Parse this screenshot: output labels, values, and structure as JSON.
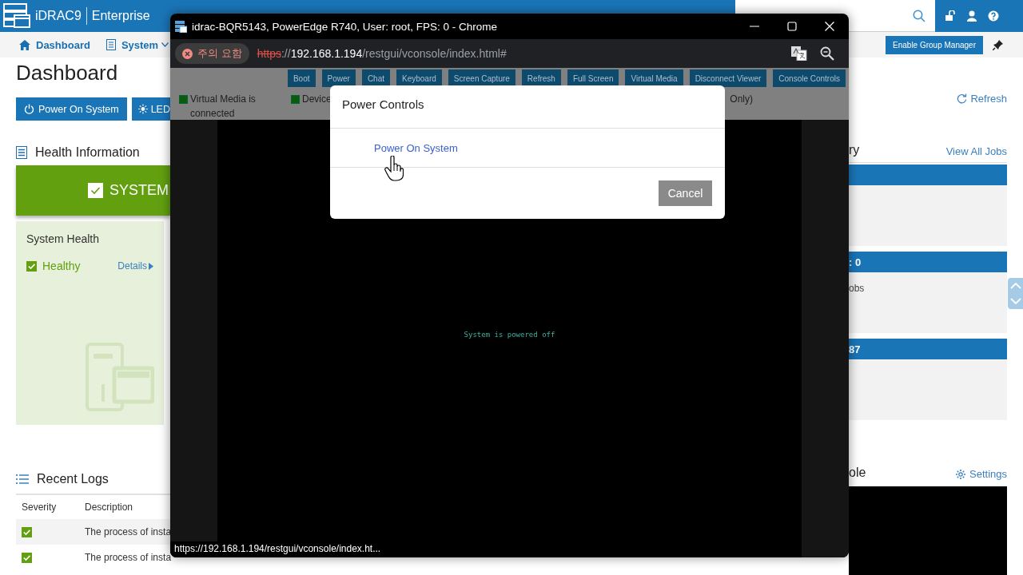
{
  "app": {
    "brand": "iDRAC9",
    "edition": "Enterprise"
  },
  "nav": {
    "items": [
      {
        "label": "Dashboard",
        "kind": "home"
      },
      {
        "label": "System",
        "kind": "menu"
      }
    ],
    "group_manager_button": "Enable Group Manager"
  },
  "page_title": "Dashboard",
  "actions": [
    {
      "label": "Power On System",
      "kind": "power"
    },
    {
      "label": "LED",
      "kind": "led"
    }
  ],
  "health": {
    "title": "Health Information",
    "banner": "SYSTEM",
    "card_title": "System Health",
    "status": "Healthy",
    "details_link": "Details"
  },
  "logs": {
    "title": "Recent Logs",
    "columns": [
      "Severity",
      "Description"
    ],
    "rows": [
      {
        "healthy": true,
        "description": "The process of insta"
      },
      {
        "healthy": true,
        "description": "The process of insta"
      }
    ]
  },
  "refresh_link": "Refresh",
  "jobs": {
    "title": "ry",
    "link": "View All Jobs",
    "panels": [
      {
        "kind": "blank"
      },
      {
        "kind": "count",
        "header": ": 0",
        "body": "obs"
      },
      {
        "kind": "count",
        "header": "87"
      }
    ]
  },
  "console_preview": {
    "title": "ole",
    "settings_link": "Settings"
  },
  "popup": {
    "title": "idrac-BQR5143, PowerEdge R740, User: root, FPS: 0 - Chrome",
    "security_badge": "주의 요함",
    "url": {
      "scheme": "https",
      "separator": "://",
      "host": "192.168.1.194",
      "path": "/restgui/vconsole/index.html#"
    },
    "toolbar": [
      "Boot",
      "Power",
      "Chat",
      "Keyboard",
      "Screen Capture",
      "Refresh",
      "Full Screen",
      "Virtual Media",
      "Disconnect Viewer",
      "Console Controls"
    ],
    "status": [
      {
        "kind": "indicator",
        "text": "Virtual Media is connected"
      },
      {
        "kind": "indicator",
        "text": "Device"
      },
      {
        "kind": "text",
        "text": "Only)"
      }
    ],
    "screen_text": "System is powered off",
    "status_url": "https://192.168.1.194/restgui/vconsole/index.ht..."
  },
  "dialog": {
    "title": "Power Controls",
    "options": [
      "Power On System"
    ],
    "cancel": "Cancel"
  }
}
